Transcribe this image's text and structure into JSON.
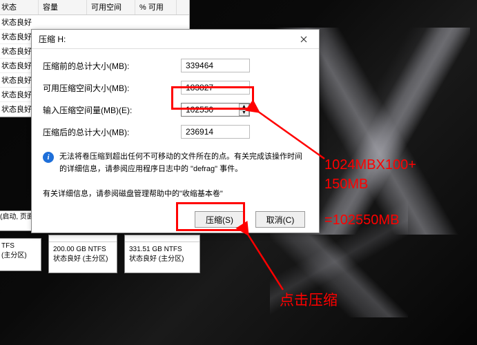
{
  "background": {
    "table_headers": [
      "状态",
      "容量",
      "可用空间",
      "% 可用"
    ],
    "row_text": "状态良好",
    "partition_d_text": "(启动, 页面",
    "partition_a": {
      "l1": "TFS",
      "l2": "(主分区)"
    },
    "partition_b": {
      "l1": "200.00 GB NTFS",
      "l2": "状态良好 (主分区)"
    },
    "partition_c": {
      "l1": "331.51 GB NTFS",
      "l2": "状态良好 (主分区)"
    }
  },
  "dialog": {
    "title": "压缩 H:",
    "field1_label": "压缩前的总计大小(MB):",
    "field1_value": "339464",
    "field2_label": "可用压缩空间大小(MB):",
    "field2_value": "183827",
    "field3_label": "输入压缩空间量(MB)(E):",
    "field3_value": "102550",
    "field4_label": "压缩后的总计大小(MB):",
    "field4_value": "236914",
    "info_text": "无法将卷压缩到超出任何不可移动的文件所在的点。有关完成该操作时间的详细信息，请参阅应用程序日志中的 \"defrag\" 事件。",
    "info_text2": "有关详细信息，请参阅磁盘管理帮助中的\"收缩基本卷\"",
    "btn_ok": "压缩(S)",
    "btn_cancel": "取消(C)"
  },
  "annotations": {
    "calc_line1": "1024MBX100+",
    "calc_line2": "150MB",
    "calc_result": "=102550MB",
    "click_hint": "点击压缩"
  }
}
